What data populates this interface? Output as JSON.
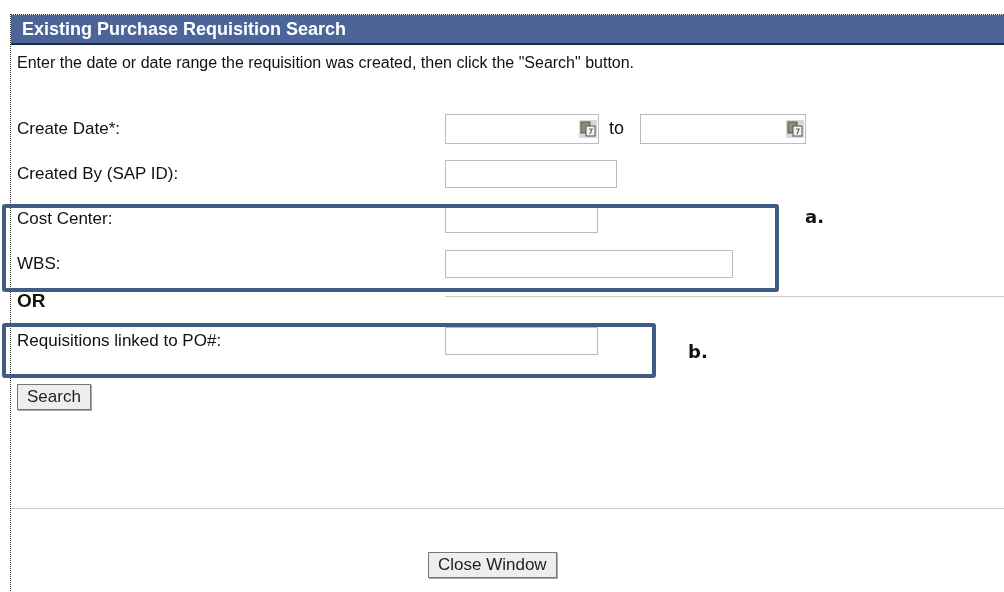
{
  "header": {
    "title": "Existing Purchase Requisition Search"
  },
  "instructions": "Enter the date or date range the requisition was created, then click the \"Search\" button.",
  "fields": [
    {
      "kind": "date_range",
      "label": "Create Date*:",
      "separator": "to"
    },
    {
      "kind": "text",
      "label": "Created By (SAP ID):"
    },
    {
      "kind": "text",
      "label": "Cost Center:"
    },
    {
      "kind": "text",
      "label": "WBS:"
    }
  ],
  "or_label": "OR",
  "po_field": {
    "label": "Requisitions linked to PO#:"
  },
  "search_button": "Search",
  "close_button": "Close Window",
  "annotations": [
    {
      "label": "a."
    },
    {
      "label": "b."
    }
  ]
}
